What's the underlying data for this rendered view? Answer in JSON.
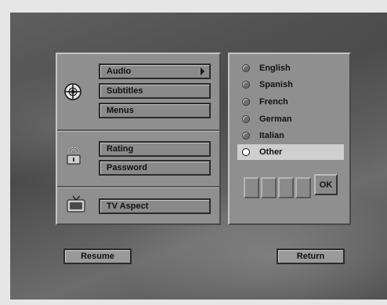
{
  "menu": {
    "audio_label": "Audio",
    "subtitles_label": "Subtitles",
    "menus_label": "Menus",
    "rating_label": "Rating",
    "password_label": "Password",
    "tv_aspect_label": "TV Aspect"
  },
  "languages": {
    "items": [
      "English",
      "Spanish",
      "French",
      "German",
      "Italian",
      "Other"
    ],
    "selected": "Other"
  },
  "code_entry": {
    "ok_label": "OK"
  },
  "footer": {
    "resume_label": "Resume",
    "return_label": "Return"
  }
}
